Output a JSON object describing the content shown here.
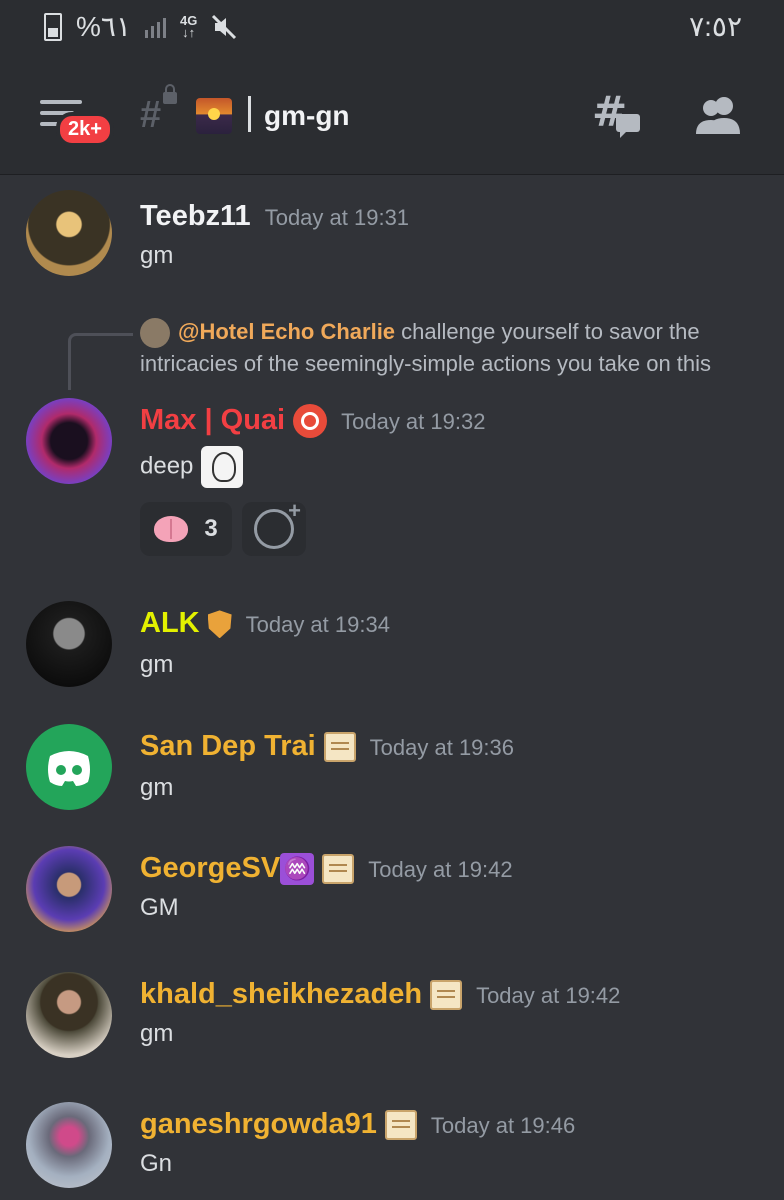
{
  "status_bar": {
    "battery": "%٦١",
    "network": "4G",
    "clock": "٧:٥٢"
  },
  "header": {
    "unread_badge": "2k+",
    "channel_name": "gm-gn"
  },
  "messages": [
    {
      "author": "Teebz11",
      "time": "Today at 19:31",
      "text": "gm",
      "name_color": "#f2f3f5"
    },
    {
      "reply_mention": "@Hotel Echo Charlie",
      "reply_text": "challenge yourself to savor the intricacies of the seemingly-simple actions you take on this",
      "author": "Max | Quai",
      "time": "Today at 19:32",
      "text": "deep",
      "name_color": "#f23f43",
      "reaction": {
        "emoji": "brain-emoji",
        "count": "3"
      }
    },
    {
      "author": "ALK",
      "time": "Today at 19:34",
      "text": "gm",
      "name_color": "#e3f100"
    },
    {
      "author": "San Dep Trai",
      "time": "Today at 19:36",
      "text": "gm",
      "name_color": "#f0b232"
    },
    {
      "author": "GeorgeSV",
      "time": "Today at 19:42",
      "text": "GM",
      "name_color": "#f0b232"
    },
    {
      "author": "khald_sheikhezadeh",
      "time": "Today at 19:42",
      "text": "gm",
      "name_color": "#f0b232"
    },
    {
      "author": "ganeshrgowda91",
      "time": "Today at 19:46",
      "text": "Gn",
      "name_color": "#f0b232"
    }
  ],
  "colors": {
    "background": "#313338",
    "header": "#2b2d31",
    "badge": "#f23f43",
    "mention": "#f0a95a",
    "discord_green": "#23a55a"
  }
}
